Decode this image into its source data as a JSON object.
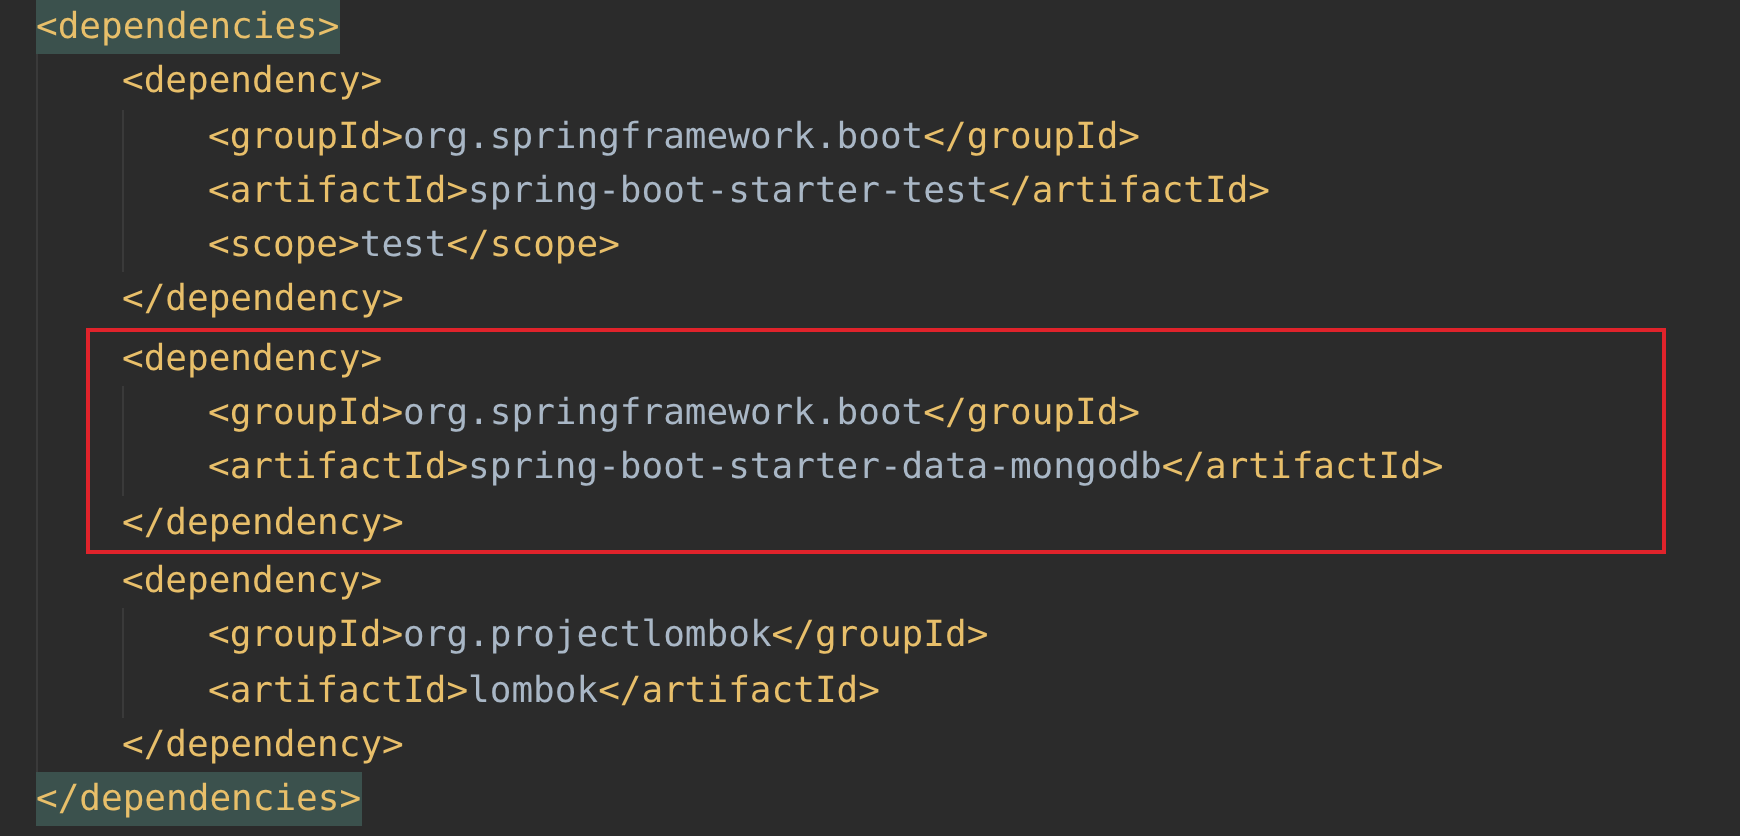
{
  "editor": {
    "root": {
      "open_tag": "<dependencies>",
      "close_tag": "</dependencies>",
      "highlighted": true,
      "boxed": false,
      "children": [
        {
          "open_tag": "<dependency>",
          "close_tag": "</dependency>",
          "highlighted": false,
          "boxed": false,
          "children": [
            {
              "open_tag": "<groupId>",
              "text": "org.springframework.boot",
              "close_tag": "</groupId>"
            },
            {
              "open_tag": "<artifactId>",
              "text": "spring-boot-starter-test",
              "close_tag": "</artifactId>"
            },
            {
              "open_tag": "<scope>",
              "text": "test",
              "close_tag": "</scope>"
            }
          ]
        },
        {
          "open_tag": "<dependency>",
          "close_tag": "</dependency>",
          "highlighted": false,
          "boxed": true,
          "children": [
            {
              "open_tag": "<groupId>",
              "text": "org.springframework.boot",
              "close_tag": "</groupId>"
            },
            {
              "open_tag": "<artifactId>",
              "text": "spring-boot-starter-data-mongodb",
              "close_tag": "</artifactId>"
            }
          ]
        },
        {
          "open_tag": "<dependency>",
          "close_tag": "</dependency>",
          "highlighted": false,
          "boxed": false,
          "children": [
            {
              "open_tag": "<groupId>",
              "text": "org.projectlombok",
              "close_tag": "</groupId>"
            },
            {
              "open_tag": "<artifactId>",
              "text": "lombok",
              "close_tag": "</artifactId>"
            }
          ]
        }
      ]
    }
  }
}
